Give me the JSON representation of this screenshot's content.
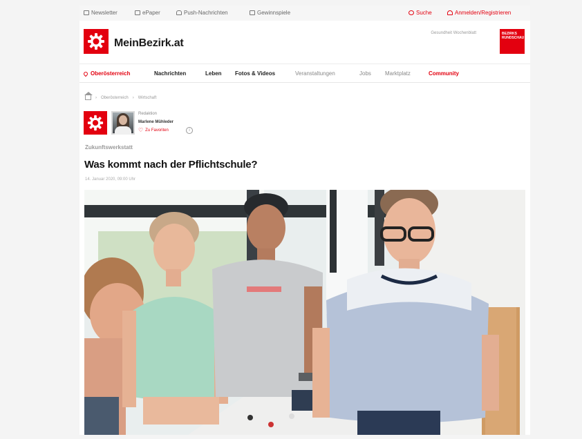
{
  "utility_bar": {
    "newsletter": "Newsletter",
    "epaper": "ePaper",
    "push": "Push-Nachrichten",
    "games": "Gewinnspiele",
    "search": "Suche",
    "login": "Anmelden/Registrieren"
  },
  "header": {
    "brand": "MeinBezirk.at",
    "small_text": "Gesundheit Wochenblatt",
    "badge_text": "BEZIRKS RUNDSCHAU"
  },
  "nav": {
    "region": "Oberösterreich",
    "items": [
      "Nachrichten",
      "Leben",
      "Fotos & Videos",
      "Veranstaltungen",
      "Jobs",
      "Marktplatz",
      "Community"
    ]
  },
  "breadcrumb": [
    "Oberösterreich",
    "Wirtschaft"
  ],
  "author": {
    "role": "Redaktion",
    "name": "Marlene Mühleder",
    "favorite": "Zu Favoriten",
    "info_symbol": "i"
  },
  "article": {
    "kicker": "Zukunftswerkstatt",
    "headline": "Was kommt nach der Pflichtschule?",
    "date": "14. Januar 2020, 09:00 Uhr"
  },
  "icons": [
    "mail-icon",
    "epaper-icon",
    "bell-icon",
    "game-icon",
    "search-icon",
    "user-icon",
    "home-icon",
    "location-pin-icon",
    "heart-icon",
    "info-icon"
  ],
  "colors": {
    "brand_red": "#e3000f",
    "text_dark": "#1b1b1b",
    "muted": "#888888",
    "background": "#f4f4f4"
  }
}
